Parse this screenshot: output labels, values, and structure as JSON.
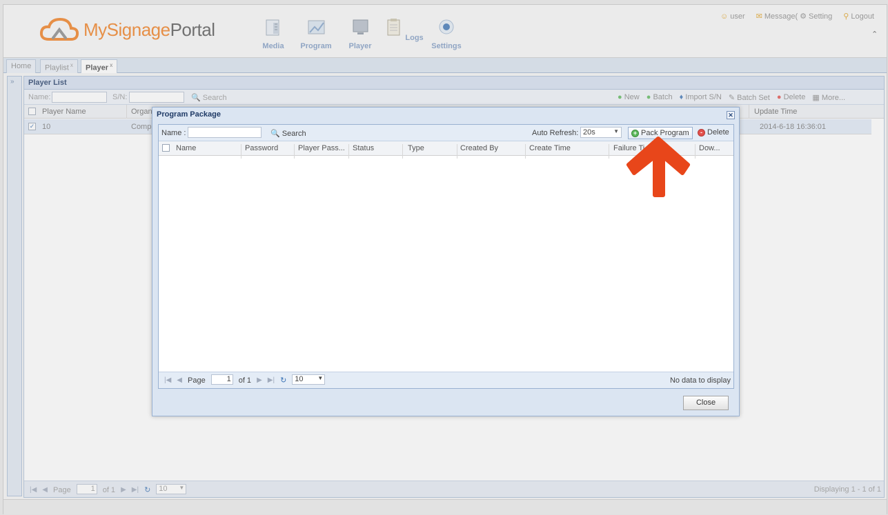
{
  "header": {
    "logo_prefix": "MySignage",
    "logo_suffix": "Portal",
    "nav": [
      {
        "label": "Media",
        "icon": "media-icon"
      },
      {
        "label": "Program",
        "icon": "program-icon"
      },
      {
        "label": "Player",
        "icon": "player-icon"
      },
      {
        "label": "Logs",
        "icon": "logs-icon"
      },
      {
        "label": "Settings",
        "icon": "settings-icon"
      }
    ],
    "user_label": "user",
    "message_label": "Message(",
    "setting_label": "Setting",
    "logout_label": "Logout"
  },
  "tabs": [
    {
      "label": "Home"
    },
    {
      "label": "Playlist"
    },
    {
      "label": "Player"
    }
  ],
  "panel": {
    "title": "Player List",
    "name_label": "Name:",
    "sn_label": "S/N:",
    "search_label": "Search",
    "toolbar": {
      "new": "New",
      "batch": "Batch",
      "import_sn": "Import S/N",
      "batch_set": "Batch Set",
      "delete": "Delete",
      "more": "More..."
    },
    "columns": {
      "player_name": "Player Name",
      "organization": "Organ",
      "update_time": "Update Time"
    },
    "rows": [
      {
        "player_name": "10",
        "organization": "Comp",
        "update_time": "2014-6-18 16:36:01"
      }
    ],
    "paging": {
      "page_label": "Page",
      "page_value": "1",
      "of_label": "of 1",
      "page_size": "10",
      "display_info": "Displaying 1 - 1 of 1"
    }
  },
  "dialog": {
    "title": "Program Package",
    "name_label": "Name :",
    "search_label": "Search",
    "auto_refresh_label": "Auto Refresh:",
    "auto_refresh_value": "20s",
    "pack_program_label": "Pack Program",
    "delete_label": "Delete",
    "columns": [
      "Name",
      "Password",
      "Player Pass...",
      "Status",
      "Type",
      "Created By",
      "Create Time",
      "Failure Ti",
      "Dow..."
    ],
    "paging": {
      "page_label": "Page",
      "page_value": "1",
      "of_label": "of 1",
      "page_size": "10",
      "empty_message": "No data to display"
    },
    "close_label": "Close"
  },
  "colors": {
    "accent_orange": "#f07d1d",
    "arrow": "#e8461a",
    "header_blue": "#1f3a66"
  }
}
